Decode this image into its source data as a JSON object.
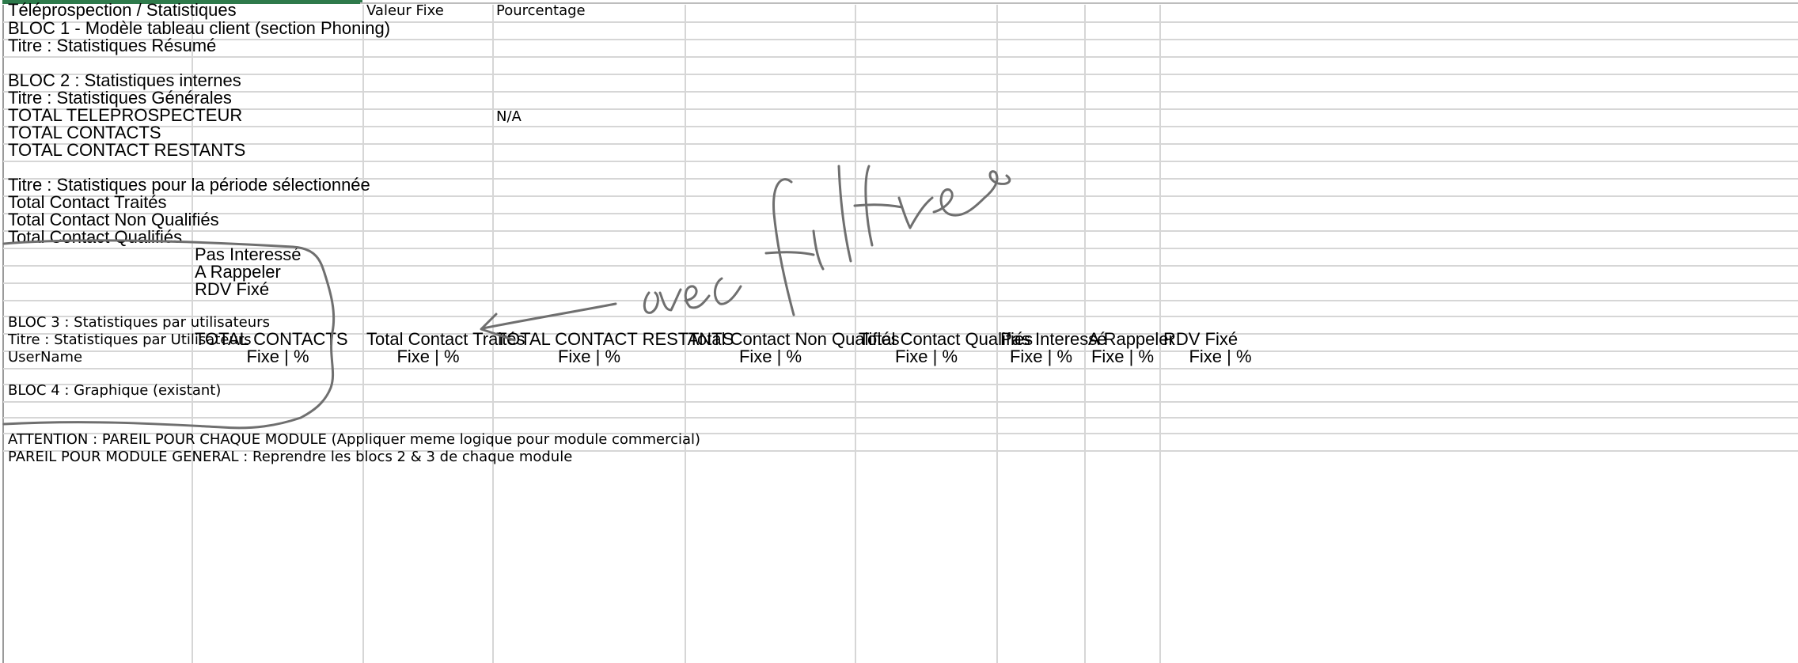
{
  "rows": {
    "r1": {
      "a": "Téléprospection / Statistiques",
      "c": "Valeur Fixe",
      "d": "Pourcentage"
    },
    "r2": {
      "a": "BLOC 1 - Modèle tableau client (section Phoning)"
    },
    "r3": {
      "a": "Titre : Statistiques Résumé"
    },
    "r5": {
      "a": "BLOC 2 : Statistiques internes"
    },
    "r6": {
      "a": "Titre : Statistiques Générales"
    },
    "r7": {
      "a": "TOTAL TELEPROSPECTEUR",
      "d": "N/A"
    },
    "r8": {
      "a": "TOTAL CONTACTS"
    },
    "r9": {
      "a": "TOTAL CONTACT RESTANTS"
    },
    "r11": {
      "a": "Titre : Statistiques pour la période sélectionnée"
    },
    "r12": {
      "a": "Total Contact Traités"
    },
    "r13": {
      "a": "Total Contact Non Qualifiés"
    },
    "r14": {
      "a": "Total Contact Qualifiés"
    },
    "r15": {
      "b": "Pas Interessé"
    },
    "r16": {
      "b": "A Rappeler"
    },
    "r17": {
      "b": "RDV Fixé"
    },
    "r19": {
      "a": "BLOC 3 : Statistiques par utilisateurs"
    },
    "r20": {
      "a": "Titre : Statistiques par Utilisateurs",
      "b": "TOTAL CONTACTS",
      "c": "Total Contact Traités",
      "d": "TOTAL CONTACT RESTANTS",
      "e": "Total Contact Non Qualifiés",
      "f": "Total Contact Qualifiés",
      "g": "Pas Interessé",
      "h": "A Rappeler",
      "i": "RDV Fixé"
    },
    "r21": {
      "a": "UserName",
      "b": "Fixe | %",
      "c": "Fixe | %",
      "d": "Fixe | %",
      "e": "Fixe | %",
      "f": "Fixe | %",
      "g": "Fixe | %",
      "h": "Fixe | %",
      "i": "Fixe | %"
    },
    "r23": {
      "a": "BLOC 4 : Graphique (existant)"
    },
    "r26": {
      "a": "ATTENTION : PAREIL POUR CHAQUE MODULE (Appliquer meme logique pour module commercial)"
    },
    "r27": {
      "a": "PAREIL POUR MODULE GENERAL : Reprendre les blocs 2 & 3 de chaque module"
    }
  },
  "annotation": {
    "text": "avec filtres",
    "style": "handwritten",
    "ink_color": "#6f6f6f"
  },
  "colors": {
    "gridline": "#d6d6d6",
    "accent": "#2e7a4b"
  }
}
